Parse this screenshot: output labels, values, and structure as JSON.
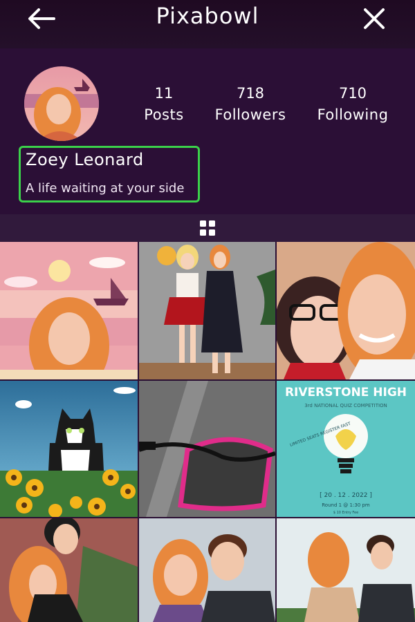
{
  "header": {
    "title": "Pixabowl",
    "back_icon": "arrow-left-icon",
    "close_icon": "close-icon"
  },
  "profile": {
    "name": "Zoey Leonard",
    "bio": "A life waiting at your side",
    "stats": [
      {
        "value": "11",
        "label": "Posts"
      },
      {
        "value": "718",
        "label": "Followers"
      },
      {
        "value": "710",
        "label": "Following"
      }
    ]
  },
  "grid_toggle_icon": "grid-view-icon",
  "posts": [
    {
      "kind": "sunset-portrait"
    },
    {
      "kind": "two-friends-standing"
    },
    {
      "kind": "selfie-friends"
    },
    {
      "kind": "cat-sunflowers"
    },
    {
      "kind": "bicycle-basket"
    },
    {
      "kind": "quiz-poster",
      "poster_title": "RIVERSTONE HIGH",
      "poster_subtitle": "3rd NATIONAL QUIZ COMPETITION",
      "poster_side": "LIMITED SEATS REGISTER FAST",
      "poster_date": "[ 20 . 12 . 2022 ]",
      "poster_round": "Round 1 @ 1:30 pm",
      "poster_fee": "$ 10 Entry Fee"
    },
    {
      "kind": "couple-hug"
    },
    {
      "kind": "couple-portrait"
    },
    {
      "kind": "couple-back"
    }
  ],
  "colors": {
    "accent_highlight": "#3bd14a",
    "header_bg": "#22091f",
    "profile_bg": "#2b0f36"
  }
}
